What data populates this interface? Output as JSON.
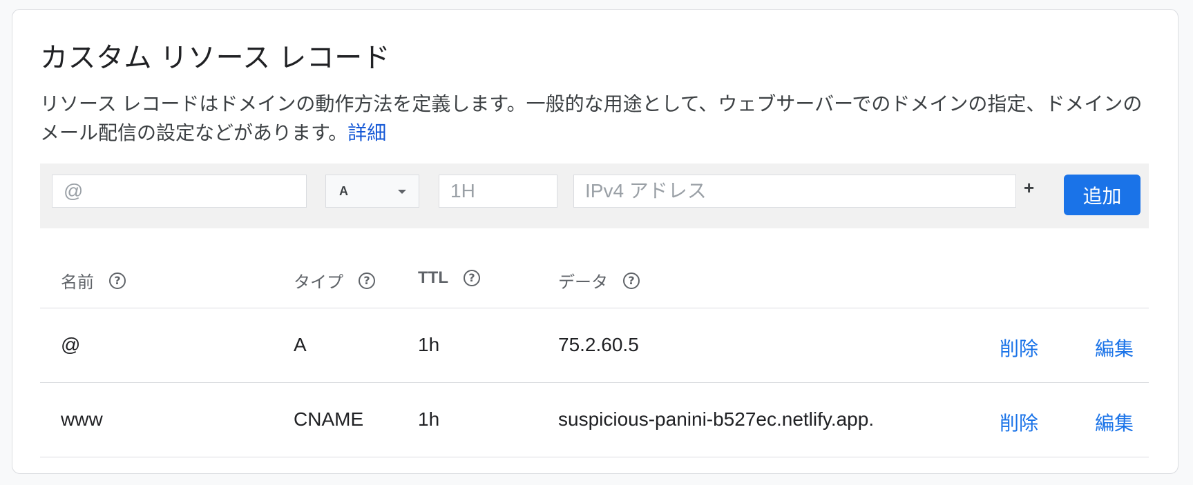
{
  "section": {
    "title": "カスタム リソース レコード",
    "description": "リソース レコードはドメインの動作方法を定義します。一般的な用途として、ウェブサーバーでのドメインの指定、ドメインのメール配信の設定などがあります。",
    "learn_more": "詳細"
  },
  "add_form": {
    "name_placeholder": "@",
    "type_value": "A",
    "ttl_placeholder": "1H",
    "data_placeholder": "IPv4 アドレス",
    "plus_label": "+",
    "add_button": "追加"
  },
  "table": {
    "headers": {
      "name": "名前",
      "type": "タイプ",
      "ttl": "TTL",
      "data": "データ",
      "help_icon": "?"
    },
    "rows": [
      {
        "name": "@",
        "type": "A",
        "ttl": "1h",
        "data": "75.2.60.5",
        "delete": "削除",
        "edit": "編集"
      },
      {
        "name": "www",
        "type": "CNAME",
        "ttl": "1h",
        "data": "suspicious-panini-b527ec.netlify.app.",
        "delete": "削除",
        "edit": "編集"
      }
    ]
  },
  "icons": {
    "help": "help-circle-icon",
    "dropdown": "chevron-down-icon"
  },
  "colors": {
    "accent": "#1a73e8",
    "link": "#1558d6"
  }
}
